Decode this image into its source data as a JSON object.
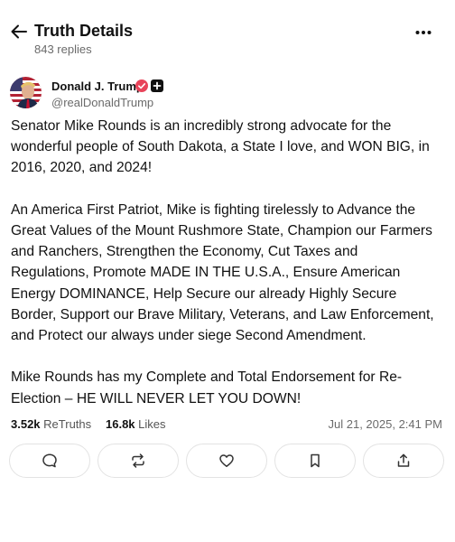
{
  "header": {
    "title": "Truth Details",
    "replies": "843 replies"
  },
  "author": {
    "name": "Donald J. Trump",
    "handle": "@realDonaldTrump",
    "verified_color": "#e8445a"
  },
  "post": {
    "paragraphs": [
      [
        "Senator Mike Rounds is an incredibly strong advocate for the",
        "wonderful people of South Dakota, a State I love, and WON BIG, in",
        "2016, 2020, and 2024!"
      ],
      [
        "An America First Patriot, Mike is fighting tirelessly to Advance the",
        "Great Values of the Mount Rushmore State, Champion our Farmers",
        "and Ranchers, Strengthen the Economy, Cut Taxes and",
        "Regulations, Promote MADE IN THE U.S.A., Ensure American",
        "Energy DOMINANCE, Help Secure our already Highly Secure",
        "Border, Support our Brave Military, Veterans, and Law Enforcement,",
        "and Protect our always under siege Second Amendment."
      ],
      [
        "Mike Rounds has my Complete and Total Endorsement for Re-",
        "Election – HE WILL NEVER LET YOU DOWN!"
      ]
    ]
  },
  "stats": {
    "retruths_count": "3.52k",
    "retruths_label": "ReTruths",
    "likes_count": "16.8k",
    "likes_label": "Likes",
    "timestamp": "Jul 21, 2025, 2:41 PM"
  },
  "actions": [
    {
      "name": "reply-button",
      "icon": "comment-icon"
    },
    {
      "name": "retruth-button",
      "icon": "repost-icon"
    },
    {
      "name": "like-button",
      "icon": "heart-icon"
    },
    {
      "name": "bookmark-button",
      "icon": "bookmark-icon"
    },
    {
      "name": "share-button",
      "icon": "share-icon"
    }
  ]
}
